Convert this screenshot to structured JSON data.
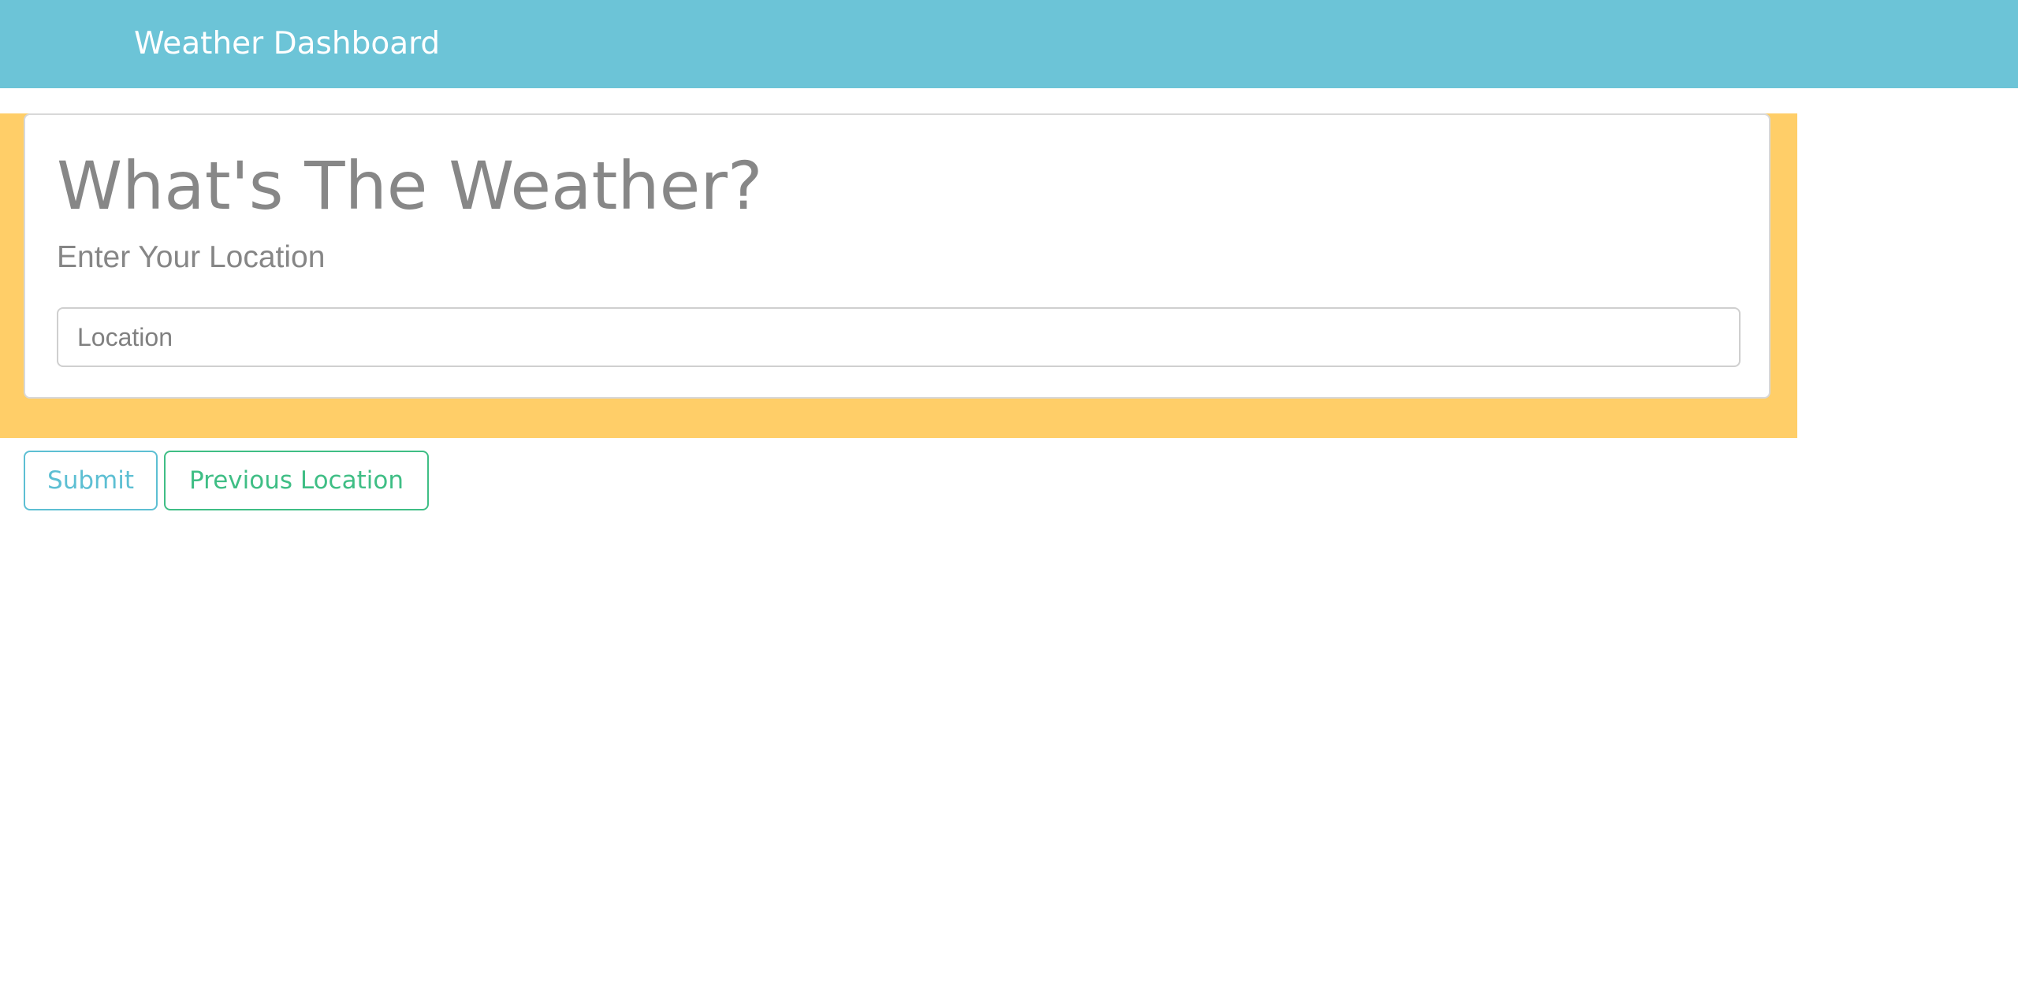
{
  "navbar": {
    "brand": "Weather Dashboard",
    "background_color": "#6cc4d7"
  },
  "hero": {
    "background_color": "#ffce68",
    "title": "What's The Weather?",
    "subtitle": "Enter Your Location",
    "location_input": {
      "placeholder": "Location",
      "value": ""
    }
  },
  "actions": {
    "submit_label": "Submit",
    "submit_color": "#5dbfd3",
    "previous_label": "Previous Location",
    "previous_color": "#3fbe85"
  }
}
